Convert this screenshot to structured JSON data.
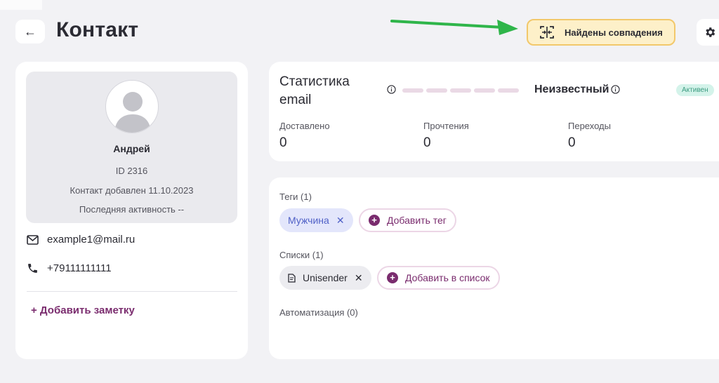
{
  "header": {
    "back_icon": "←",
    "title": "Контакт",
    "matches_button": "Найдены совпадения",
    "settings_icon": "gear-icon"
  },
  "profile": {
    "name": "Андрей",
    "id_text": "ID 2316",
    "added_text": "Контакт добавлен 11.10.2023",
    "activity_text": "Последняя активность --",
    "email": "example1@mail.ru",
    "phone": "+79111111111",
    "add_note": "+ Добавить заметку"
  },
  "stats": {
    "title": "Статистика email",
    "status": "Неизвестный",
    "badge": "Активен",
    "metrics": [
      {
        "label": "Доставлено",
        "value": "0"
      },
      {
        "label": "Прочтения",
        "value": "0"
      },
      {
        "label": "Переходы",
        "value": "0"
      }
    ]
  },
  "tags": {
    "label": "Теги (1)",
    "items": [
      "Мужчина"
    ],
    "add_label": "Добавить тег",
    "remove_glyph": "✕",
    "plus_glyph": "+"
  },
  "lists": {
    "label": "Списки (1)",
    "items": [
      "Unisender"
    ],
    "add_label": "Добавить в список"
  },
  "automation": {
    "label": "Автоматизация (0)"
  },
  "colors": {
    "accent": "#7a2c6e",
    "matches_bg": "#fdf0c9",
    "matches_border": "#f2c86b",
    "arrow": "#2fb54a",
    "badge_bg": "#d4f3ea",
    "badge_text": "#3b9b80",
    "tag_bg": "#e3e6fb",
    "tag_text": "#5061c7"
  }
}
